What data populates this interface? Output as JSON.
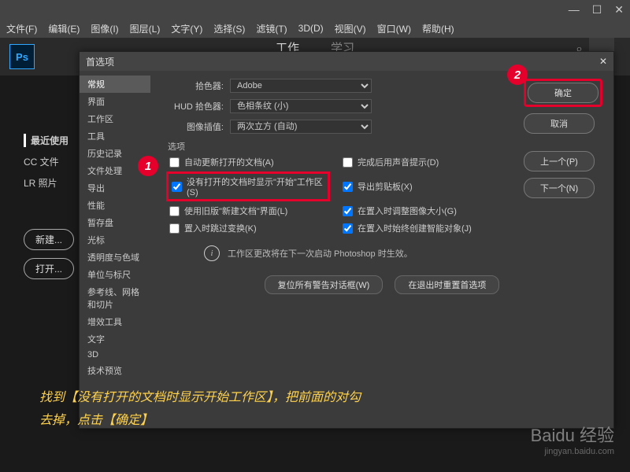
{
  "window": {
    "minimize": "—",
    "maximize": "☐",
    "close": "✕"
  },
  "menu": [
    "文件(F)",
    "编辑(E)",
    "图像(I)",
    "图层(L)",
    "文字(Y)",
    "选择(S)",
    "滤镜(T)",
    "3D(D)",
    "视图(V)",
    "窗口(W)",
    "帮助(H)"
  ],
  "ps_logo": "Ps",
  "work_tabs": {
    "work": "工作",
    "learn": "学习"
  },
  "left": {
    "recent": "最近使用",
    "cc": "CC 文件",
    "lr": "LR 照片",
    "new": "新建...",
    "open": "打开..."
  },
  "dialog": {
    "title": "首选项",
    "close": "✕",
    "sidebar": [
      "常规",
      "界面",
      "工作区",
      "工具",
      "历史记录",
      "文件处理",
      "导出",
      "性能",
      "暂存盘",
      "光标",
      "透明度与色域",
      "单位与标尺",
      "参考线、网格和切片",
      "增效工具",
      "文字",
      "3D",
      "技术预览"
    ],
    "rows": {
      "picker_label": "拾色器:",
      "picker_value": "Adobe",
      "hud_label": "HUD 拾色器:",
      "hud_value": "色相条纹 (小)",
      "interp_label": "图像插值:",
      "interp_value": "两次立方 (自动)"
    },
    "options_label": "选项",
    "checks": {
      "c1": "自动更新打开的文档(A)",
      "c2": "完成后用声音提示(D)",
      "c3": "没有打开的文档时显示\"开始\"工作区(S)",
      "c4": "导出剪贴板(X)",
      "c5": "使用旧版\"新建文档\"界面(L)",
      "c6": "在置入时调整图像大小(G)",
      "c7": "置入时跳过变换(K)",
      "c8": "在置入时始终创建智能对象(J)"
    },
    "info": "工作区更改将在下一次启动 Photoshop 时生效。",
    "btn_reset": "复位所有警告对话框(W)",
    "btn_quit_reset": "在退出时重置首选项",
    "btn_ok": "确定",
    "btn_cancel": "取消",
    "btn_prev": "上一个(P)",
    "btn_next": "下一个(N)"
  },
  "markers": {
    "m1": "1",
    "m2": "2"
  },
  "caption_l1": "找到【没有打开的文档时显示开始工作区】，把前面的对勾",
  "caption_l2": "去掉，点击【确定】",
  "watermark": {
    "brand": "Baidu 经验",
    "url": "jingyan.baidu.com"
  }
}
